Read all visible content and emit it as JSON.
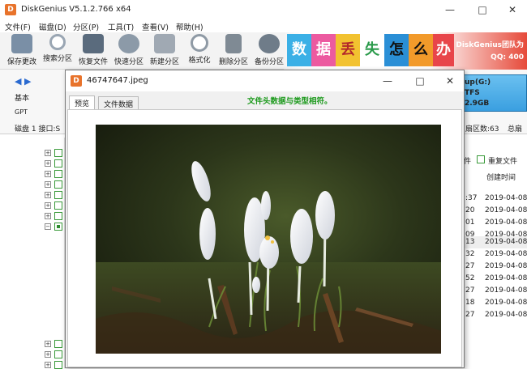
{
  "app": {
    "title": "DiskGenius V5.1.2.766 x64",
    "icon_letter": "D",
    "controls": {
      "minimize": "—",
      "maximize": "□",
      "close": "✕"
    }
  },
  "menu": [
    "文件(F)",
    "磁盘(D)",
    "分区(P)",
    "工具(T)",
    "查看(V)",
    "帮助(H)"
  ],
  "toolbar": [
    {
      "label": "保存更改",
      "icon": "save-icon",
      "color": "#7a8fa6"
    },
    {
      "label": "搜索分区",
      "icon": "search-icon",
      "color": "#9aa6b3"
    },
    {
      "label": "恢复文件",
      "icon": "recover-icon",
      "color": "#5a6b7d"
    },
    {
      "label": "快速分区",
      "icon": "quick-partition-icon",
      "color": "#8c9aa8"
    },
    {
      "label": "新建分区",
      "icon": "new-partition-icon",
      "color": "#a0a9b3"
    },
    {
      "label": "格式化",
      "icon": "format-icon",
      "color": "#8f9aa5"
    },
    {
      "label": "删除分区",
      "icon": "delete-icon",
      "color": "#7f8a94"
    },
    {
      "label": "备份分区",
      "icon": "backup-icon",
      "color": "#6f7c89"
    }
  ],
  "banner": {
    "chars": [
      {
        "ch": "数",
        "bg": "#3bb0e6",
        "fg": "#ffffff"
      },
      {
        "ch": "据",
        "bg": "#ec5aa0",
        "fg": "#ffffff"
      },
      {
        "ch": "丢",
        "bg": "#f2c230",
        "fg": "#b2282a"
      },
      {
        "ch": "失",
        "bg": "#ffffff",
        "fg": "#2a9a4a"
      },
      {
        "ch": "怎",
        "bg": "#2a8fd6",
        "fg": "#111111"
      },
      {
        "ch": "么",
        "bg": "#f29a2a",
        "fg": "#111111"
      },
      {
        "ch": "办",
        "bg": "#e8454a",
        "fg": "#ffffff"
      }
    ],
    "tagline": "DiskGenius团队为",
    "qq": "QQ: 400"
  },
  "infobar": {
    "nav_back": "◀",
    "nav_forward": "▶",
    "basic": "基本",
    "gpt": "GPT",
    "disk_info": "磁盘 1 接口:S",
    "disk_label": "up(G:)",
    "fs": "TFS",
    "size": "2.9GB",
    "sectors": "扇区数:63",
    "total": "总扇"
  },
  "list": {
    "header_a": "件",
    "header_dup": "重复文件",
    "header_ctime": "创建时间",
    "rows": [
      {
        "t": ":37",
        "d": "2019-04-08"
      },
      {
        "t": "20",
        "d": "2019-04-08"
      },
      {
        "t": "01",
        "d": "2019-04-08"
      },
      {
        "t": "09",
        "d": "2019-04-08"
      },
      {
        "t": "13",
        "d": "2019-04-08",
        "sel": true
      },
      {
        "t": "32",
        "d": "2019-04-08"
      },
      {
        "t": "27",
        "d": "2019-04-08"
      },
      {
        "t": "52",
        "d": "2019-04-08"
      },
      {
        "t": "27",
        "d": "2019-04-08"
      },
      {
        "t": "18",
        "d": "2019-04-08"
      },
      {
        "t": "27",
        "d": "2019-04-08"
      }
    ]
  },
  "dialog": {
    "title": "46747647.jpeg",
    "icon_letter": "D",
    "tabs": [
      "预览",
      "文件数据"
    ],
    "active_tab": 0,
    "status": "文件头数据与类型相符。",
    "controls": {
      "minimize": "—",
      "maximize": "□",
      "close": "✕"
    }
  },
  "colors": {
    "accent_green": "#1e9a1e",
    "banner_red": "#e64a3a"
  }
}
